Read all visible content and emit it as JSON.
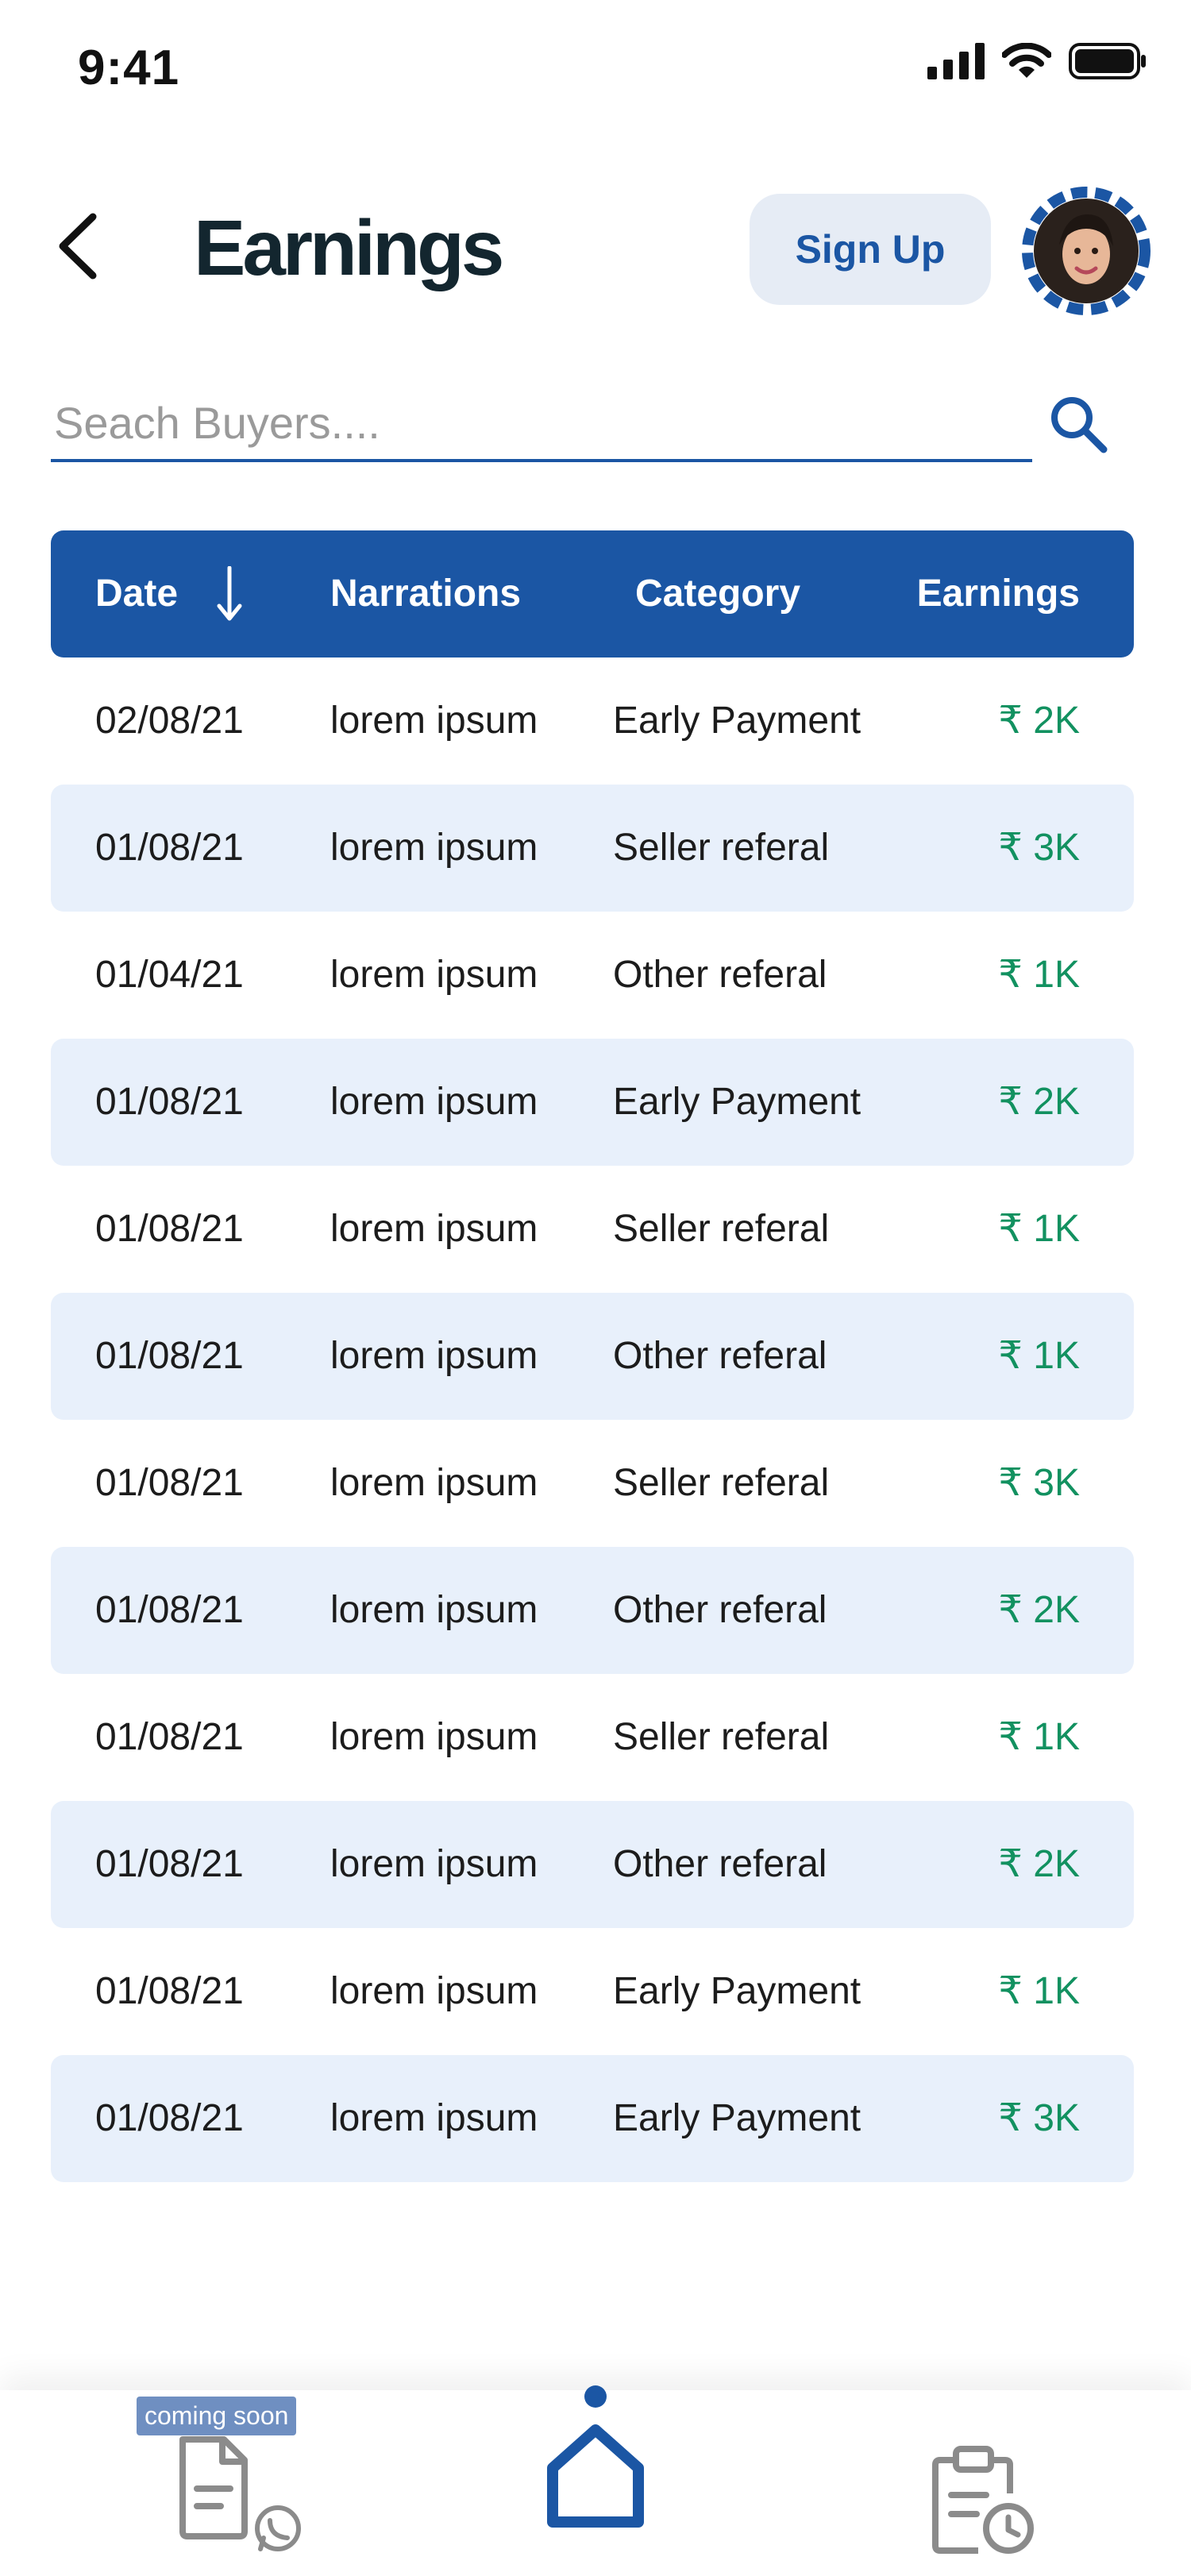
{
  "status_bar": {
    "time": "9:41"
  },
  "header": {
    "title": "Earnings",
    "signup_label": "Sign Up"
  },
  "search": {
    "placeholder": "Seach Buyers...."
  },
  "table": {
    "columns": {
      "date": "Date",
      "narrations": "Narrations",
      "category": "Category",
      "earnings": "Earnings"
    },
    "rows": [
      {
        "date": "02/08/21",
        "narration": "lorem ipsum",
        "category": "Early Payment",
        "earning": "₹ 2K"
      },
      {
        "date": "01/08/21",
        "narration": "lorem ipsum",
        "category": "Seller referal",
        "earning": "₹ 3K"
      },
      {
        "date": "01/04/21",
        "narration": "lorem ipsum",
        "category": "Other referal",
        "earning": "₹ 1K"
      },
      {
        "date": "01/08/21",
        "narration": "lorem ipsum",
        "category": "Early Payment",
        "earning": "₹ 2K"
      },
      {
        "date": "01/08/21",
        "narration": "lorem ipsum",
        "category": "Seller referal",
        "earning": "₹ 1K"
      },
      {
        "date": "01/08/21",
        "narration": "lorem ipsum",
        "category": "Other referal",
        "earning": "₹ 1K"
      },
      {
        "date": "01/08/21",
        "narration": "lorem ipsum",
        "category": "Seller referal",
        "earning": "₹ 3K"
      },
      {
        "date": "01/08/21",
        "narration": "lorem ipsum",
        "category": "Other referal",
        "earning": "₹ 2K"
      },
      {
        "date": "01/08/21",
        "narration": "lorem ipsum",
        "category": "Seller referal",
        "earning": "₹ 1K"
      },
      {
        "date": "01/08/21",
        "narration": "lorem ipsum",
        "category": "Other referal",
        "earning": "₹ 2K"
      },
      {
        "date": "01/08/21",
        "narration": "lorem ipsum",
        "category": "Early Payment",
        "earning": "₹ 1K"
      },
      {
        "date": "01/08/21",
        "narration": "lorem ipsum",
        "category": "Early Payment",
        "earning": "₹ 3K"
      }
    ]
  },
  "bottom_nav": {
    "coming_soon_label": "coming soon",
    "items": [
      {
        "icon": "document-whatsapp-icon"
      },
      {
        "icon": "home-icon",
        "active": true
      },
      {
        "icon": "clipboard-clock-icon"
      }
    ]
  },
  "colors": {
    "primary": "#1b56a4",
    "row_alt": "#e8f0fb",
    "earning_green": "#129160",
    "title": "#13262f"
  }
}
